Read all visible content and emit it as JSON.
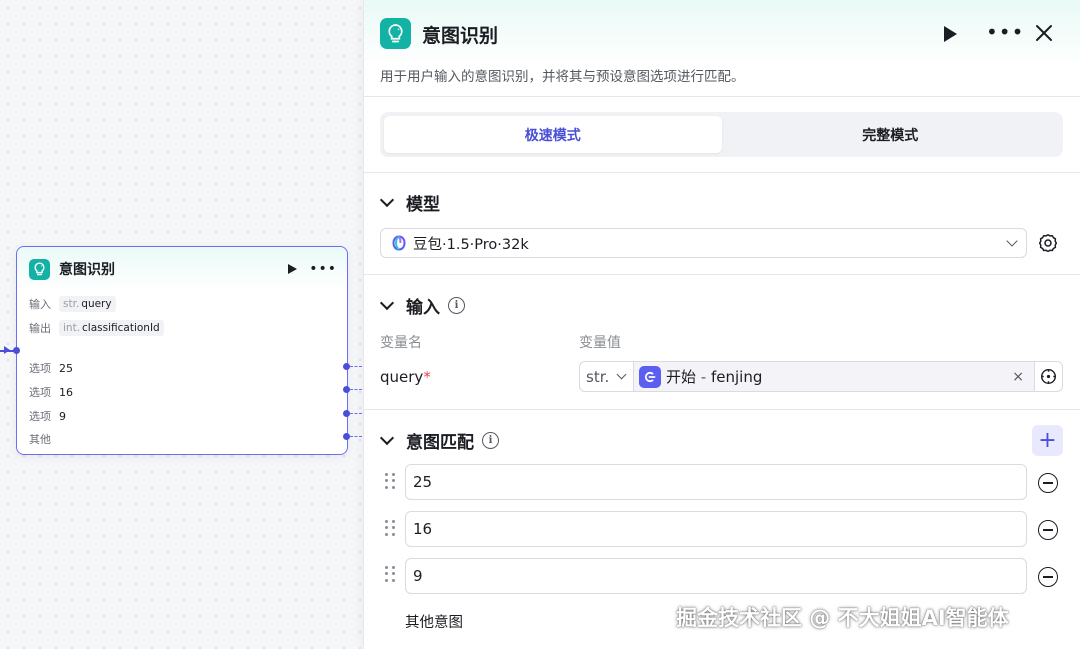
{
  "node": {
    "title": "意图识别",
    "input_label": "输入",
    "input_type": "str.",
    "input_value": "query",
    "output_label": "输出",
    "output_type": "int.",
    "output_value": "classificationId",
    "options": [
      {
        "label": "选项",
        "value": "25"
      },
      {
        "label": "选项",
        "value": "16"
      },
      {
        "label": "选项",
        "value": "9"
      }
    ],
    "other_label": "其他"
  },
  "panel": {
    "title": "意图识别",
    "description": "用于用户输入的意图识别，并将其与预设意图选项进行匹配。",
    "modes": [
      "极速模式",
      "完整模式"
    ],
    "active_mode": "极速模式",
    "model_section": "模型",
    "model_name": "豆包·1.5·Pro·32k",
    "input_section": "输入",
    "col_var_name": "变量名",
    "col_var_value": "变量值",
    "var_name": "query",
    "var_type": "str.",
    "ref_source": "开始",
    "ref_sep": " - ",
    "ref_var": "fenjing",
    "intent_section": "意图匹配",
    "intents": [
      "25",
      "16",
      "9"
    ],
    "other_intent": "其他意图"
  },
  "watermark": "掘金技术社区 @ 不大姐姐AI智能体",
  "colors": {
    "accent": "#4a4fd6",
    "brand_teal": "#12b3a5",
    "node_border": "#6b6ef0",
    "required": "#e5484d"
  }
}
